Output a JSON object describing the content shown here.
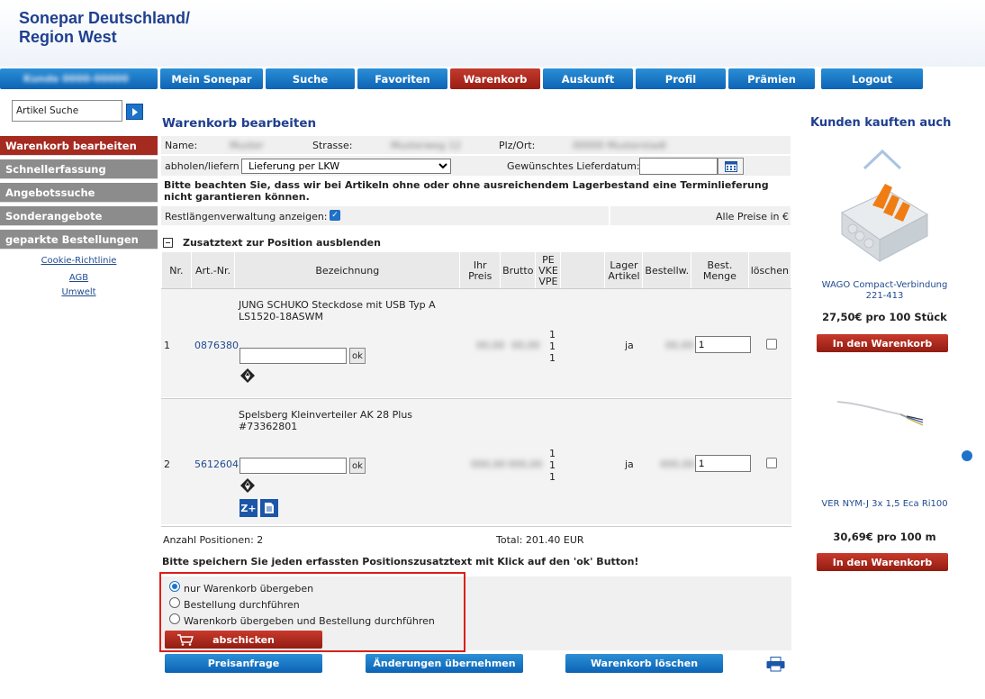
{
  "brand": {
    "line1": "Sonepar Deutschland/",
    "line2": "Region West"
  },
  "nav": {
    "user": "Kunde 0000-00000",
    "items": [
      "Mein Sonepar",
      "Suche",
      "Favoriten",
      "Warenkorb",
      "Auskunft",
      "Profil",
      "Prämien",
      "Logout"
    ]
  },
  "sidebar": {
    "search_value": "Artikel Suche",
    "items": [
      "Warenkorb bearbeiten",
      "Schnellerfassung",
      "Angebotssuche",
      "Sonderangebote",
      "geparkte Bestellungen"
    ],
    "links": [
      "Cookie-Richtlinie",
      "AGB",
      "Umwelt"
    ]
  },
  "main": {
    "title": "Warenkorb bearbeiten",
    "name_label": "Name:",
    "name_value": "Muster",
    "street_label": "Strasse:",
    "street_value": "Musterweg 12",
    "city_label": "Plz/Ort:",
    "city_value": "00000 Musterstadt",
    "delivery_label": "abholen/liefern",
    "delivery_value": "Lieferung per LKW",
    "date_label": "Gewünschtes Lieferdatum:",
    "notice": "Bitte beachten Sie, dass wir bei Artikeln ohne oder ohne ausreichendem Lagerbestand eine Terminlieferung nicht garantieren können.",
    "restlaenge_label": "Restlängenverwaltung anzeigen:",
    "prices_label": "Alle Preise in €",
    "zusatz_label": "Zusatztext zur Position ausblenden",
    "headers": {
      "nr": "Nr.",
      "art": "Art.-Nr.",
      "bez": "Bezeichnung",
      "ihr1": "Ihr",
      "ihr2": "Preis",
      "brutto": "Brutto",
      "pe1": "PE",
      "pe2": "VKE",
      "pe3": "VPE",
      "lager1": "Lager",
      "lager2": "Artikel",
      "bestellw": "Bestellw.",
      "menge1": "Best.",
      "menge2": "Menge",
      "loeschen": "löschen"
    },
    "items": [
      {
        "nr": "1",
        "art": "0876380",
        "bez1": "JUNG SCHUKO Steckdose mit USB Typ A",
        "bez2": "LS1520-18ASWM",
        "ihr": "00,00",
        "brutto": "00,00",
        "pe": [
          "1",
          "1",
          "1"
        ],
        "lager": "ja",
        "bestellw": "00,00",
        "menge": "1",
        "ok": "ok"
      },
      {
        "nr": "2",
        "art": "5612604",
        "bez1": "Spelsberg Kleinverteiler AK 28 Plus",
        "bez2": "#73362801",
        "ihr": "000,00",
        "brutto": "000,00",
        "pe": [
          "1",
          "1",
          "1"
        ],
        "lager": "ja",
        "bestellw": "000,00",
        "menge": "1",
        "ok": "ok",
        "z_label": "Z+"
      }
    ],
    "count_label": "Anzahl Positionen: 2",
    "total_label": "Total: 201.40 EUR",
    "save_notice": "Bitte speichern Sie jeden erfassten Positionszusatztext mit Klick auf den 'ok' Button!",
    "options": [
      "nur Warenkorb übergeben",
      "Bestellung durchführen",
      "Warenkorb übergeben und Bestellung durchführen"
    ],
    "submit": "abschicken",
    "buttons": [
      "Preisanfrage",
      "Änderungen übernehmen",
      "Warenkorb löschen"
    ]
  },
  "right": {
    "title": "Kunden kauften auch",
    "products": [
      {
        "name1": "WAGO Compact-Verbindung",
        "name2": "221-413",
        "price": "27,50€ pro 100 Stück",
        "button": "In den Warenkorb"
      },
      {
        "name1": "VER NYM-J 3x 1,5 Eca Ri100",
        "name2": "",
        "price": "30,69€ pro 100 m",
        "button": "In den Warenkorb"
      }
    ]
  },
  "colors": {
    "brand": "#1f3f8f",
    "nav_blue": "#1e73c9",
    "active_red": "#a52a20",
    "highlight_border": "#d9201a"
  }
}
